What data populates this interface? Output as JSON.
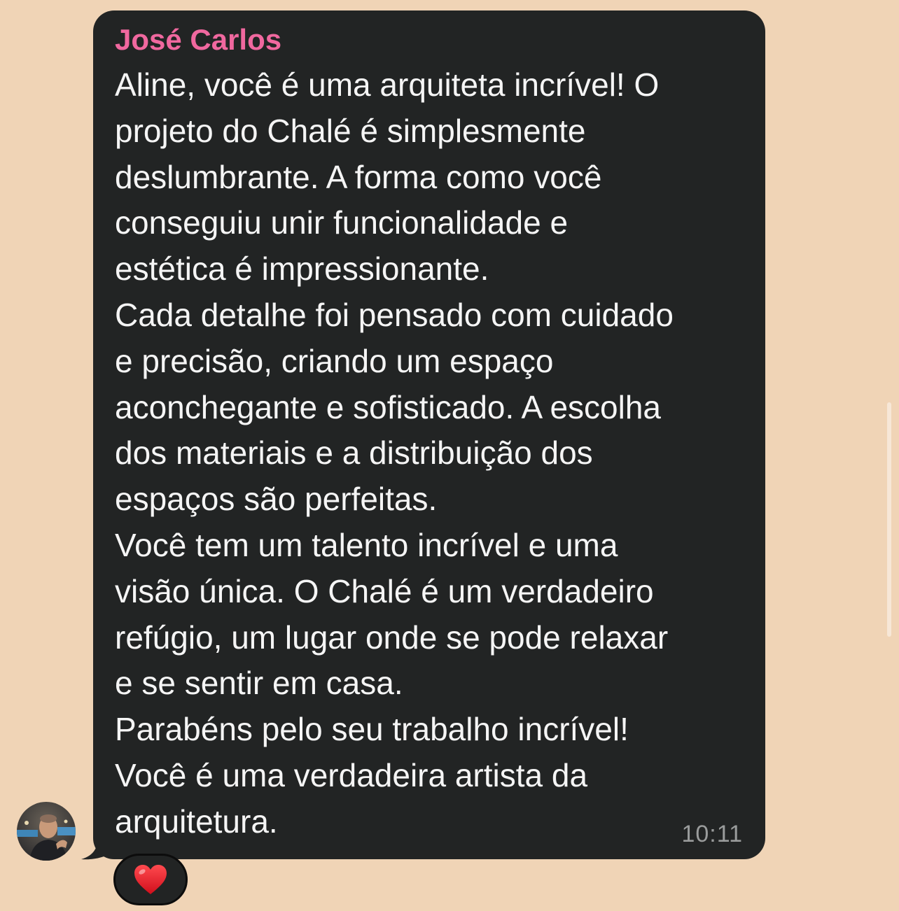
{
  "message": {
    "sender": "José Carlos",
    "lines": [
      "Aline, você é uma arquiteta incrível! O",
      "projeto do Chalé é simplesmente",
      "deslumbrante. A forma como você",
      "conseguiu unir funcionalidade e",
      "estética é impressionante.",
      "Cada detalhe foi pensado com cuidado",
      "e precisão, criando um espaço",
      "aconchegante e sofisticado. A escolha",
      "dos materiais e a distribuição dos",
      "espaços são perfeitas.",
      "Você tem um talento incrível e uma",
      "visão única. O Chalé é um verdadeiro",
      "refúgio, um lugar onde se pode relaxar",
      "e se sentir em casa.",
      "Parabéns pelo seu trabalho incrível!",
      "Você é uma verdadeira artista da",
      "arquitetura."
    ],
    "time": "10:11",
    "reaction": "heart-icon"
  },
  "colors": {
    "background": "#f0d4b6",
    "bubble": "#222424",
    "sender_name": "#f0689f",
    "message_text": "#f5f5f5",
    "timestamp": "#9a9c9c",
    "reaction_heart": "#e8202a"
  }
}
